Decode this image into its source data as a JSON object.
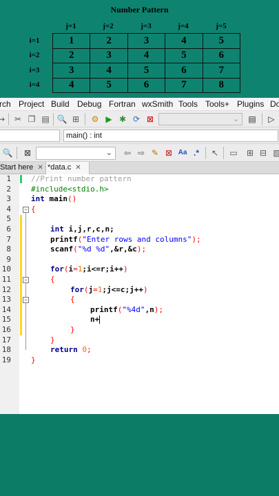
{
  "pattern": {
    "title": "Number Pattern",
    "columns": [
      "j=1",
      "j=2",
      "j=3",
      "j=4",
      "j=5"
    ],
    "rows": [
      {
        "label": "i=1",
        "values": [
          "1",
          "2",
          "3",
          "4",
          "5"
        ]
      },
      {
        "label": "i=2",
        "values": [
          "2",
          "3",
          "4",
          "5",
          "6"
        ]
      },
      {
        "label": "i=3",
        "values": [
          "3",
          "4",
          "5",
          "6",
          "7"
        ]
      },
      {
        "label": "i=4",
        "values": [
          "4",
          "5",
          "6",
          "7",
          "8"
        ]
      }
    ]
  },
  "menu": [
    "rch",
    "Project",
    "Build",
    "Debug",
    "Fortran",
    "wxSmith",
    "Tools",
    "Tools+",
    "Plugins",
    "Do"
  ],
  "scope": {
    "function": "main() : int"
  },
  "tabs": [
    {
      "label": "Start here",
      "close": "✕"
    },
    {
      "label": "*data.c",
      "close": "✕"
    }
  ],
  "editor": {
    "line_numbers": [
      "1",
      "2",
      "3",
      "4",
      "5",
      "6",
      "7",
      "8",
      "9",
      "10",
      "11",
      "12",
      "13",
      "14",
      "15",
      "16",
      "17",
      "18",
      "19"
    ],
    "lines": {
      "l1": "//Print number pattern",
      "l2": "#include<stdio.h>",
      "l3_kw": "int",
      "l3_fn": " main",
      "l3_p": "()",
      "l4": "{",
      "l6_kw": "int",
      "l6_rest": " i,j,r,c,n;",
      "l7_fn": "printf",
      "l7_p1": "(",
      "l7_str": "\"Enter rows and columns\"",
      "l7_p2": ");",
      "l8_fn": "scanf",
      "l8_p1": "(",
      "l8_str": "\"%d %d\"",
      "l8_rest": ",&r,&c",
      "l8_p2": ");",
      "l10_kw": "for",
      "l10_p1": "(",
      "l10_a": "i",
      "l10_eq": "=",
      "l10_n1": "1",
      "l10_b": ";i<=r;i++",
      "l10_p2": ")",
      "l11": "{",
      "l12_kw": "for",
      "l12_p1": "(",
      "l12_a": "j",
      "l12_eq": "=",
      "l12_n1": "1",
      "l12_b": ";j<=c;j++",
      "l12_p2": ")",
      "l13": "{",
      "l14_fn": "printf",
      "l14_p1": "(",
      "l14_str": "\"%4d\"",
      "l14_rest": ",n",
      "l14_p2": ");",
      "l15": "n+",
      "l16": "}",
      "l17": "}",
      "l18_kw": "return",
      "l18_n": " 0",
      "l18_p": ";",
      "l19": "}"
    }
  },
  "colors": {
    "background": "#0d7c66",
    "keyword": "#00008b",
    "comment": "#a0a0a0",
    "preprocessor": "#008000",
    "string": "#0000ff",
    "number": "#f07000",
    "change_marker": "#ffd51c"
  }
}
